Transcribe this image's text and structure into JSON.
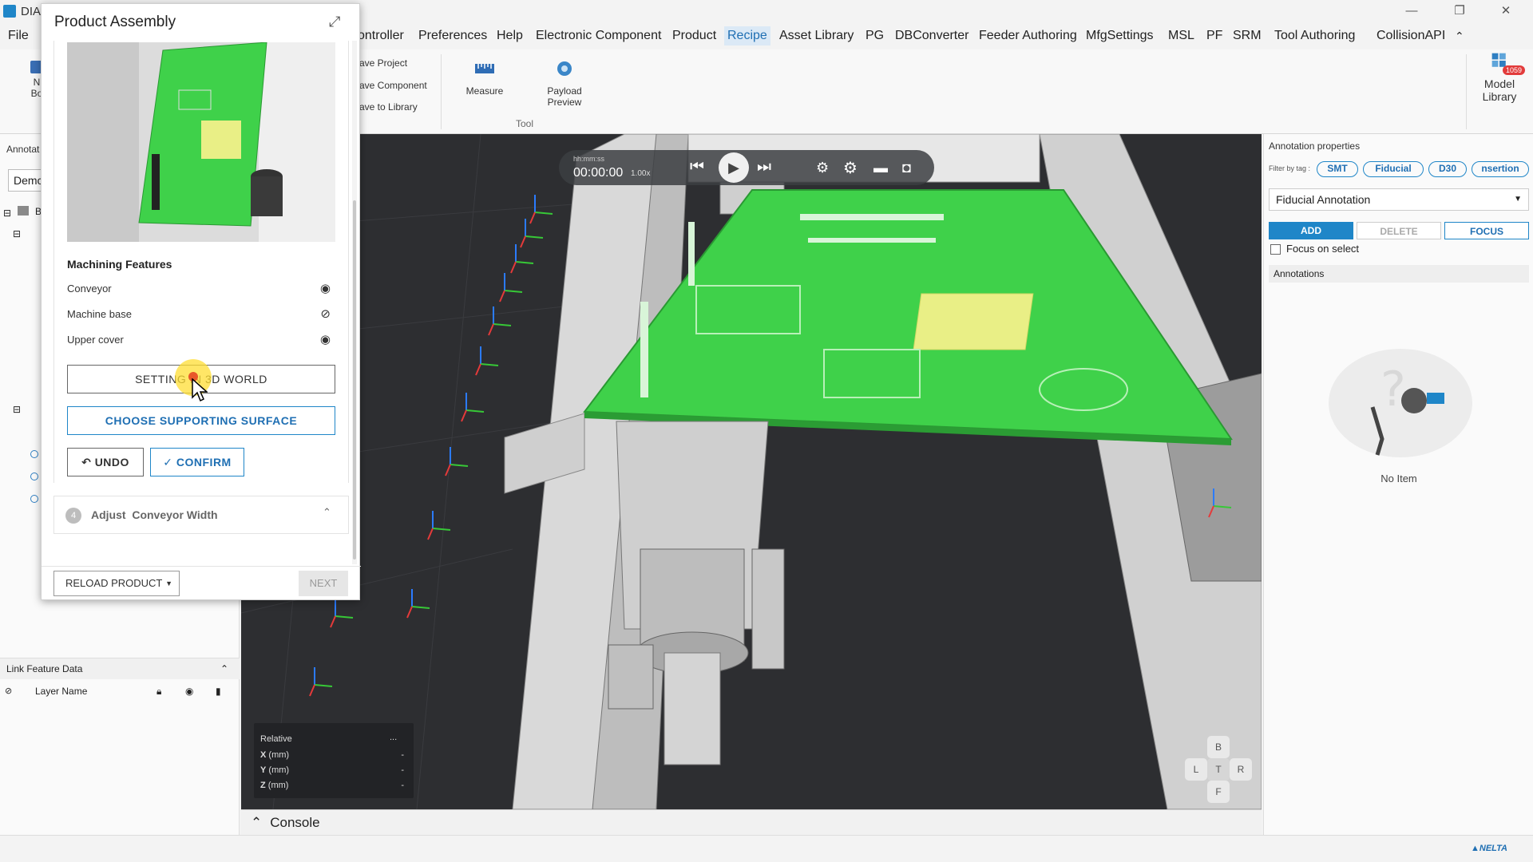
{
  "app": {
    "title": "DIA",
    "window_controls": {
      "minimize": "—",
      "maximize": "❐",
      "close": "✕"
    }
  },
  "menu": {
    "items": [
      {
        "label": "File",
        "active": false
      },
      {
        "label": "ontroller",
        "active": false
      },
      {
        "label": "Preferences",
        "active": false
      },
      {
        "label": "Help",
        "active": false
      },
      {
        "label": "Electronic Component",
        "active": false
      },
      {
        "label": "Product",
        "active": false
      },
      {
        "label": "Recipe",
        "active": true
      },
      {
        "label": "Asset Library",
        "active": false
      },
      {
        "label": "PG",
        "active": false
      },
      {
        "label": "DBConverter",
        "active": false
      },
      {
        "label": "Feeder Authoring",
        "active": false
      },
      {
        "label": "MfgSettings",
        "active": false
      },
      {
        "label": "MSL",
        "active": false
      },
      {
        "label": "PF",
        "active": false
      },
      {
        "label": "SRM",
        "active": false
      },
      {
        "label": "Tool Authoring",
        "active": false
      },
      {
        "label": "CollisionAPI",
        "active": false
      }
    ],
    "collapse_glyph": "⌃"
  },
  "ribbon": {
    "left_partial": {
      "line1": "N",
      "line2": "Bo"
    },
    "project_items": [
      "ave Project",
      "ave Component",
      "ave to Library"
    ],
    "measure_label": "Measure",
    "payload_label_1": "Payload",
    "payload_label_2": "Preview",
    "tool_group_label": "Tool",
    "model_library_label_1": "Model",
    "model_library_label_2": "Library",
    "model_library_badge": "1059"
  },
  "left_panel": {
    "header": "Annotat",
    "dropdown_value": "Demc",
    "tree_root_label": "B"
  },
  "link_panel": {
    "title": "Link Feature Data",
    "column_layer_name": "Layer Name"
  },
  "modal": {
    "title": "Product Assembly",
    "section_title": "Machining Features",
    "features": [
      {
        "label": "Conveyor",
        "visible": true
      },
      {
        "label": "Machine base",
        "visible": false
      },
      {
        "label": "Upper cover",
        "visible": true
      }
    ],
    "setting_button": "SETTING IN 3D WORLD",
    "choose_button": "CHOOSE SUPPORTING SURFACE",
    "undo_button": "UNDO",
    "confirm_button": "CONFIRM",
    "step": {
      "number": "4",
      "label": "Adjust  Conveyor Width"
    },
    "reload_button": "RELOAD PRODUCT",
    "next_button": "NEXT"
  },
  "playback": {
    "time_format": "hh:mm:ss",
    "time_value": "00:00:00",
    "speed": "1.00x"
  },
  "coord_box": {
    "title": "Relative",
    "menu": "...",
    "rows": [
      {
        "label": "X",
        "unit": "(mm)",
        "value": "-"
      },
      {
        "label": "Y",
        "unit": "(mm)",
        "value": "-"
      },
      {
        "label": "Z",
        "unit": "(mm)",
        "value": "-"
      }
    ]
  },
  "nav_cube": {
    "top": "B",
    "left": "L",
    "center": "T",
    "right": "R",
    "bottom": "F"
  },
  "console": {
    "label": "Console"
  },
  "right_panel": {
    "title": "Annotation properties",
    "filter_label": "Filter by tag :",
    "tags": [
      "SMT",
      "Fiducial",
      "D30",
      "nsertion"
    ],
    "annotation_type": "Fiducial Annotation",
    "add_button": "ADD",
    "delete_button": "DELETE",
    "focus_button": "FOCUS",
    "focus_on_select_label": "Focus on select",
    "annotations_header": "Annotations",
    "empty_label": "No Item"
  },
  "status": {
    "brand": "NELTA"
  },
  "colors": {
    "accent": "#1f86c8",
    "pcb_green": "#3fd14a",
    "viewport_bg": "#2d2e31",
    "badge_red": "#e23b3b"
  }
}
